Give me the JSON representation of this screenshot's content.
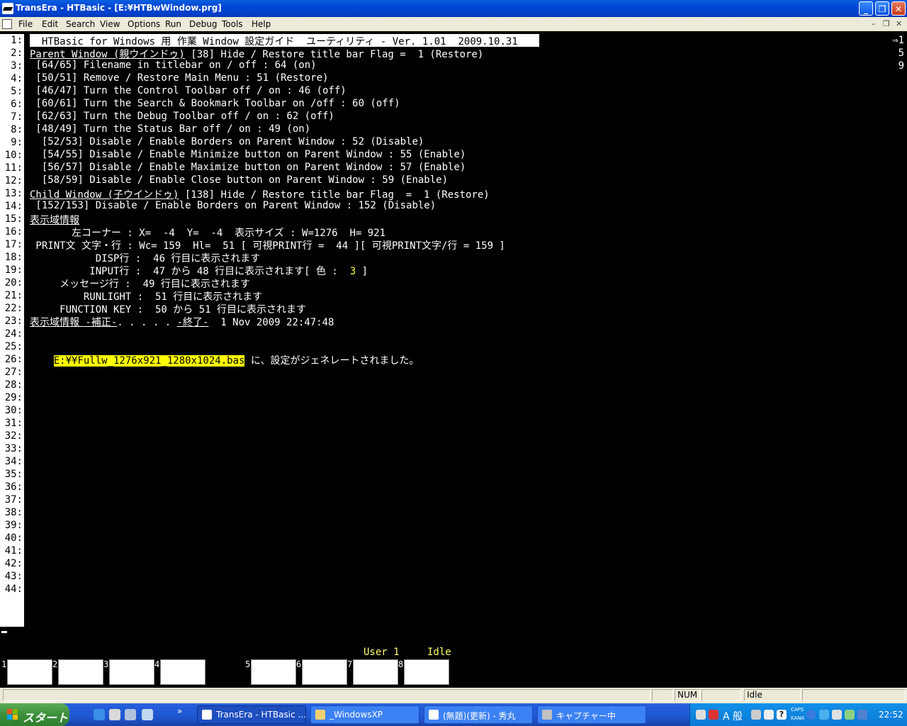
{
  "window": {
    "title": "TransEra - HTBasic - [E:¥HTBwWindow.prg]",
    "buttons": {
      "minimize": "_",
      "maximize": "❐",
      "close": "✕"
    }
  },
  "menu": {
    "items": [
      "File",
      "Edit",
      "Search",
      "View",
      "Options",
      "Run",
      "Debug",
      "Tools",
      "Help"
    ],
    "mdi_controls": {
      "minimize": "–",
      "restore": "❐",
      "close": "✕"
    }
  },
  "editor": {
    "lines": [
      {
        "n": "1:",
        "text": "  HTBasic for Windows 用 作業 Window 設定ガイド  ユーティリティ - Ver. 1.01  2009.10.31"
      },
      {
        "n": "2:",
        "u": "Parent Window (親ウインドゥ)",
        "text": " [38] Hide / Restore title bar Flag =  1 (Restore)"
      },
      {
        "n": "3:",
        "text": " [64/65] Filename in titlebar on / off : 64 (on)"
      },
      {
        "n": "4:",
        "text": " [50/51] Remove / Restore Main Menu : 51 (Restore)"
      },
      {
        "n": "5:",
        "text": " [46/47] Turn the Control Toolbar off / on : 46 (off)"
      },
      {
        "n": "6:",
        "text": " [60/61] Turn the Search & Bookmark Toolbar on /off : 60 (off)"
      },
      {
        "n": "7:",
        "text": " [62/63] Turn the Debug Toolbar off / on : 62 (off)"
      },
      {
        "n": "8:",
        "text": " [48/49] Turn the Status Bar off / on : 49 (on)"
      },
      {
        "n": "9:",
        "text": "  [52/53] Disable / Enable Borders on Parent Window : 52 (Disable)"
      },
      {
        "n": "10:",
        "text": "  [54/55] Disable / Enable Minimize button on Parent Window : 55 (Enable)"
      },
      {
        "n": "11:",
        "text": "  [56/57] Disable / Enable Maximize button on Parent Window : 57 (Enable)"
      },
      {
        "n": "12:",
        "text": "  [58/59] Disable / Enable Close button on Parent Window : 59 (Enable)"
      },
      {
        "n": "13:",
        "u": "Child Window (子ウインドゥ)",
        "text": " [138] Hide / Restore title bar Flag  =  1 (Restore)"
      },
      {
        "n": "14:",
        "text": " [152/153] Disable / Enable Borders on Parent Window : 152 (Disable)"
      },
      {
        "n": "15:",
        "u": "表示域情報",
        "text": ""
      },
      {
        "n": "16:",
        "text": "       左コーナー : X=  -4  Y=  -4  表示サイズ : W=1276  H= 921"
      },
      {
        "n": "17:",
        "text": " PRINT文 文字・行 : Wc= 159  Hl=  51 [ 可視PRINT行 =  44 ][ 可視PRINT文字/行 = 159 ]"
      },
      {
        "n": "18:",
        "text": "           DISP行 :  46 行目に表示されます"
      },
      {
        "n": "19:",
        "text": "          INPUT行 :  47 から 48 行目に表示されます[ 色 :  ",
        "y": "3",
        "tail": " ]"
      },
      {
        "n": "20:",
        "text": "     メッセージ行 :  49 行目に表示されます"
      },
      {
        "n": "21:",
        "text": "         RUNLIGHT :  51 行目に表示されます"
      },
      {
        "n": "22:",
        "text": "     FUNCTION KEY :  50 から 51 行目に表示されます"
      },
      {
        "n": "23:",
        "u2a": "表示域情報 -補正-",
        "text": ". . . . . ",
        "u2b": "-終了-",
        "tail": "  1 Nov 2009 22:47:48"
      },
      {
        "n": "24:",
        "text": ""
      },
      {
        "n": "25:",
        "text": ""
      },
      {
        "n": "26:",
        "pre": "    ",
        "hl": "E:¥¥Fullw_1276x921_1280x1024.bas",
        "text": " に、設定がジェネレートされました。"
      },
      {
        "n": "27:"
      },
      {
        "n": "28:"
      },
      {
        "n": "29:"
      },
      {
        "n": "30:"
      },
      {
        "n": "31:"
      },
      {
        "n": "32:"
      },
      {
        "n": "33:"
      },
      {
        "n": "34:"
      },
      {
        "n": "35:"
      },
      {
        "n": "36:"
      },
      {
        "n": "37:"
      },
      {
        "n": "38:"
      },
      {
        "n": "39:"
      },
      {
        "n": "40:"
      },
      {
        "n": "41:"
      },
      {
        "n": "42:"
      },
      {
        "n": "43:"
      },
      {
        "n": "44:"
      }
    ],
    "right_marks": [
      "⇒1",
      "5",
      "9"
    ],
    "run_status": {
      "user": "User 1",
      "state": "Idle"
    },
    "function_keys": [
      "1",
      "2",
      "3",
      "4",
      "5",
      "6",
      "7",
      "8"
    ]
  },
  "statusbar": {
    "num": "NUM",
    "state": "Idle"
  },
  "taskbar": {
    "start_label": "スタート",
    "chevron": "»",
    "tasks": [
      {
        "label": "TransEra - HTBasic ...",
        "active": true
      },
      {
        "label": "_WindowsXP",
        "active": false
      },
      {
        "label": "(無題)(更新) - 秀丸",
        "active": false
      },
      {
        "label": "キャプチャー中",
        "active": false
      }
    ],
    "tray": {
      "ime": "A 般",
      "caps": "CAPS",
      "kana": "KANA",
      "clock": "22:52"
    }
  },
  "colors": {
    "titlebar": "#0046d5",
    "highlight": "#ffff00",
    "run_status": "#ffff66"
  }
}
